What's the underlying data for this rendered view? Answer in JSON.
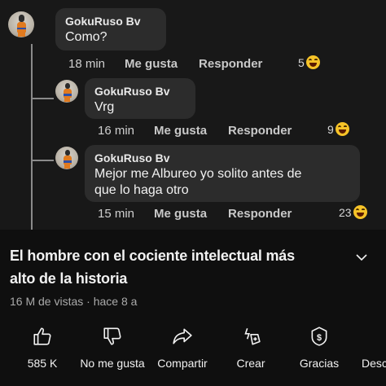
{
  "comments": [
    {
      "author": "GokuRuso Bv",
      "text": "Como?",
      "time": "18 min",
      "like_label": "Me gusta",
      "reply_label": "Responder",
      "reaction_count": "5"
    },
    {
      "author": "GokuRuso Bv",
      "text": "Vrg",
      "time": "16 min",
      "like_label": "Me gusta",
      "reply_label": "Responder",
      "reaction_count": "9"
    },
    {
      "author": "GokuRuso Bv",
      "text_line1": "Mejor me Albureo yo solito antes de",
      "text_line2": "que lo haga otro",
      "time": "15 min",
      "like_label": "Me gusta",
      "reply_label": "Responder",
      "reaction_count": "23"
    }
  ],
  "video": {
    "title_line1": "El hombre con el cociente intelectual más",
    "title_line2": "alto de la historia",
    "meta": "16 M de vistas · hace 8 a"
  },
  "actions": [
    {
      "label": "585 K",
      "icon": "thumbs-up-icon"
    },
    {
      "label": "No me gusta",
      "icon": "thumbs-down-icon"
    },
    {
      "label": "Compartir",
      "icon": "share-icon"
    },
    {
      "label": "Crear",
      "icon": "create-icon"
    },
    {
      "label": "Gracias",
      "icon": "thanks-icon"
    },
    {
      "label": "Desc",
      "icon": "download-icon"
    }
  ],
  "colors": {
    "background": "#0f0f0f",
    "comment_bg": "#181818",
    "bubble": "#2c2c2c",
    "reaction": "#f6c328"
  }
}
